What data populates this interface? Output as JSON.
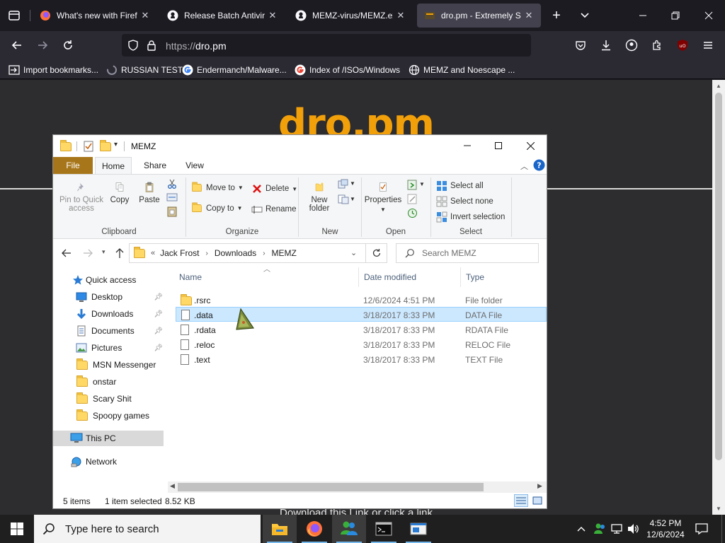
{
  "browser": {
    "tabs": [
      {
        "title": "What's new with Firefox",
        "icon": "firefox-icon",
        "active": false
      },
      {
        "title": "Release Batch Antivirus",
        "icon": "github-icon",
        "active": false
      },
      {
        "title": "MEMZ-virus/MEMZ.exe",
        "icon": "github-icon",
        "active": false
      },
      {
        "title": "dro.pm - Extremely Short",
        "icon": "dro-icon",
        "active": true
      }
    ],
    "url_scheme": "https://",
    "url_host": "dro.pm",
    "bookmarks": [
      {
        "label": "Import bookmarks...",
        "icon": "import-icon"
      },
      {
        "label": "RUSSIAN TEST",
        "icon": "loading-icon"
      },
      {
        "label": "Endermanch/Malware...",
        "icon": "google-icon"
      },
      {
        "label": "Index of /ISOs/Windows",
        "icon": "google-icon"
      },
      {
        "label": "MEMZ and Noescape ...",
        "icon": "globe-icon"
      }
    ]
  },
  "page": {
    "brand": "dro.pm",
    "footer_text": "Download this Link or click a link",
    "brand_color": "#f2a00a"
  },
  "explorer": {
    "title": "MEMZ",
    "ribbon_tabs": [
      "File",
      "Home",
      "Share",
      "View"
    ],
    "clipboard": {
      "pin": "Pin to Quick access",
      "copy": "Copy",
      "paste": "Paste",
      "label": "Clipboard"
    },
    "organize": {
      "move_to": "Move to",
      "copy_to": "Copy to",
      "delete": "Delete",
      "rename": "Rename",
      "label": "Organize"
    },
    "new": {
      "new_folder": "New folder",
      "label": "New"
    },
    "open": {
      "properties": "Properties",
      "label": "Open"
    },
    "select": {
      "select_all": "Select all",
      "select_none": "Select none",
      "invert": "Invert selection",
      "label": "Select"
    },
    "breadcrumb": [
      "Jack Frost",
      "Downloads",
      "MEMZ"
    ],
    "search_placeholder": "Search MEMZ",
    "nav": {
      "quick_access": "Quick access",
      "items": [
        {
          "label": "Desktop",
          "icon": "desktop-icon",
          "pinned": true
        },
        {
          "label": "Downloads",
          "icon": "downloads-icon",
          "pinned": true
        },
        {
          "label": "Documents",
          "icon": "documents-icon",
          "pinned": true
        },
        {
          "label": "Pictures",
          "icon": "pictures-icon",
          "pinned": true
        },
        {
          "label": "MSN Messenger",
          "icon": "folder-icon",
          "pinned": false
        },
        {
          "label": "onstar",
          "icon": "folder-icon",
          "pinned": false
        },
        {
          "label": "Scary Shit",
          "icon": "folder-icon",
          "pinned": false
        },
        {
          "label": "Spoopy games",
          "icon": "folder-icon",
          "pinned": false
        }
      ],
      "this_pc": "This PC",
      "network": "Network"
    },
    "columns": [
      "Name",
      "Date modified",
      "Type"
    ],
    "files": [
      {
        "name": ".rsrc",
        "date": "12/6/2024 4:51 PM",
        "type": "File folder",
        "kind": "folder",
        "selected": false
      },
      {
        "name": ".data",
        "date": "3/18/2017 8:33 PM",
        "type": "DATA File",
        "kind": "file",
        "selected": true
      },
      {
        "name": ".rdata",
        "date": "3/18/2017 8:33 PM",
        "type": "RDATA File",
        "kind": "file",
        "selected": false
      },
      {
        "name": ".reloc",
        "date": "3/18/2017 8:33 PM",
        "type": "RELOC File",
        "kind": "file",
        "selected": false
      },
      {
        "name": ".text",
        "date": "3/18/2017 8:33 PM",
        "type": "TEXT File",
        "kind": "file",
        "selected": false
      }
    ],
    "status": {
      "items": "5 items",
      "selected": "1 item selected",
      "size": "8.52 KB"
    }
  },
  "taskbar": {
    "search_placeholder": "Type here to search",
    "time": "4:52 PM",
    "date": "12/6/2024"
  }
}
